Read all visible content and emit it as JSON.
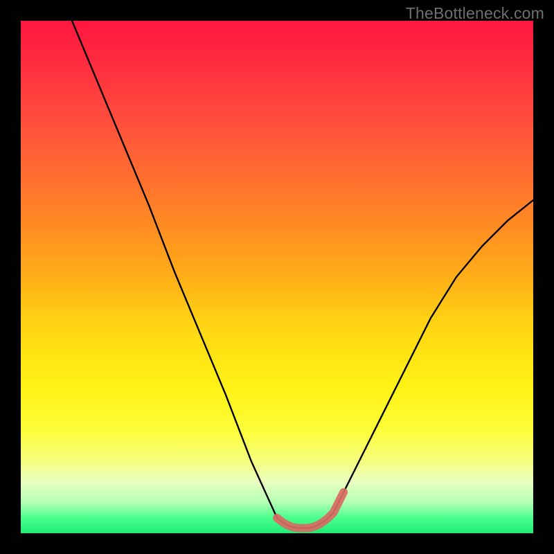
{
  "watermark": "TheBottleneck.com",
  "chart_data": {
    "type": "line",
    "title": "",
    "xlabel": "",
    "ylabel": "",
    "xlim": [
      0,
      100
    ],
    "ylim": [
      0,
      100
    ],
    "background_gradient": {
      "top": "#ff173f",
      "bottom": "#1fea78"
    },
    "series": [
      {
        "name": "bottleneck-curve",
        "color": "#000000",
        "x": [
          10,
          15,
          20,
          25,
          30,
          35,
          40,
          45,
          50,
          51,
          52,
          53,
          54,
          55,
          56,
          57,
          58,
          59,
          60,
          61,
          62,
          63,
          70,
          75,
          80,
          85,
          90,
          95,
          100
        ],
        "y": [
          100,
          88,
          76,
          64,
          51,
          39,
          27,
          14,
          3,
          2.2,
          1.6,
          1.2,
          1.0,
          1.0,
          1.0,
          1.2,
          1.6,
          2.2,
          3,
          4,
          6,
          8,
          22,
          32,
          42,
          50,
          56,
          61,
          65
        ]
      },
      {
        "name": "optimal-zone-highlight",
        "color": "#d86b63",
        "x": [
          50,
          51,
          52,
          53,
          54,
          55,
          56,
          57,
          58,
          59,
          60,
          61,
          62,
          63
        ],
        "y": [
          3,
          2.2,
          1.6,
          1.2,
          1.0,
          1.0,
          1.0,
          1.2,
          1.6,
          2.2,
          3,
          4,
          6,
          8
        ]
      }
    ]
  }
}
